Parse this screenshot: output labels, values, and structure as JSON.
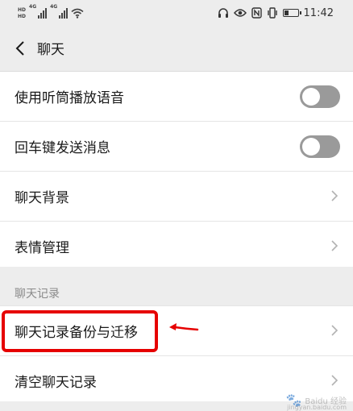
{
  "status_bar": {
    "time": "11:42",
    "left_indicators": [
      "HD",
      "HD",
      "4G",
      "4G"
    ],
    "left_icons": [
      "signal-icon",
      "signal-icon",
      "wifi-icon"
    ],
    "right_icons": [
      "headset-icon",
      "eye-icon",
      "nfc-icon",
      "vibrate-icon",
      "battery-icon"
    ],
    "battery_level": 0.35
  },
  "nav": {
    "title": "聊天",
    "back_icon": "chevron-left-icon"
  },
  "settings": [
    {
      "label": "使用听筒播放语音",
      "control": "toggle",
      "on": false
    },
    {
      "label": "回车键发送消息",
      "control": "toggle",
      "on": false
    },
    {
      "label": "聊天背景",
      "control": "chevron"
    },
    {
      "label": "表情管理",
      "control": "chevron"
    }
  ],
  "section": {
    "title": "聊天记录"
  },
  "history": [
    {
      "label": "聊天记录备份与迁移",
      "control": "chevron"
    },
    {
      "label": "清空聊天记录",
      "control": "chevron"
    }
  ],
  "annotation": {
    "color": "#e60000"
  },
  "colors": {
    "toggle_off": "#9a9a9a",
    "background": "#ededed",
    "section_text": "#8a8a8a"
  },
  "watermark": {
    "brand": "Baidu 经验",
    "url": "jingyan.baidu.com"
  }
}
